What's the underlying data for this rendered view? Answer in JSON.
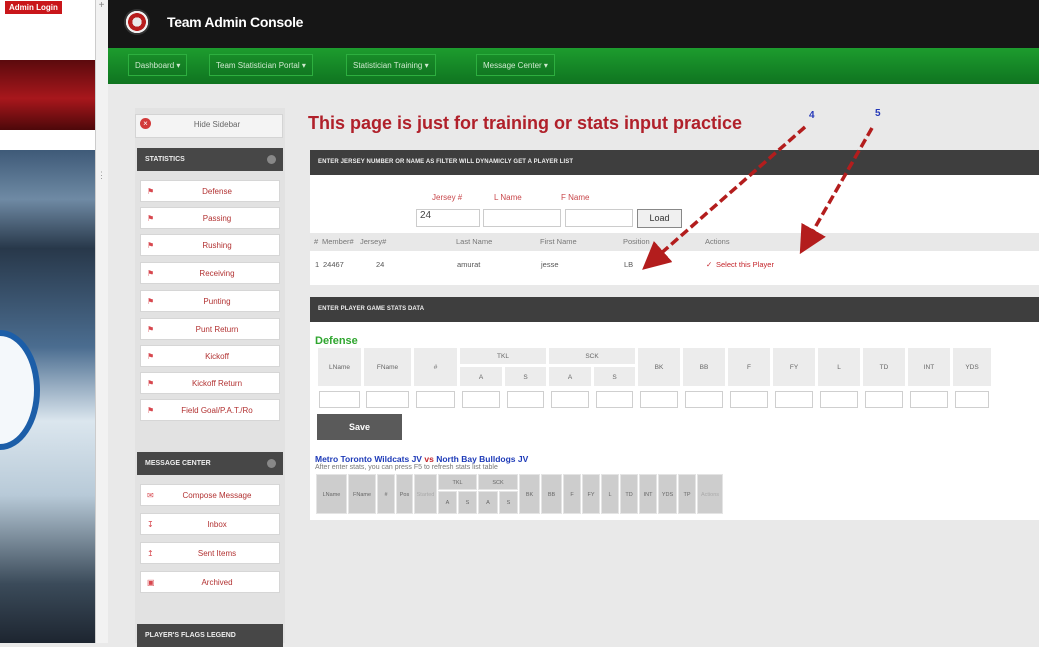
{
  "left_panel": {
    "admin_login": "Admin Login",
    "scroll_plus": "+",
    "scroll_mark": "⋮"
  },
  "header": {
    "app_title": "Team Admin Console"
  },
  "nav": {
    "items": [
      {
        "label": "Dashboard ▾"
      },
      {
        "label": "Team Statistician Portal ▾"
      },
      {
        "label": "Statistician Training ▾"
      },
      {
        "label": "Message Center ▾"
      }
    ]
  },
  "sidebar": {
    "hide_label": "Hide Sidebar",
    "statistics_heading": "STATISTICS",
    "statistics_items": [
      {
        "label": "Defense",
        "icon": "flag-icon"
      },
      {
        "label": "Passing",
        "icon": "flag-icon"
      },
      {
        "label": "Rushing",
        "icon": "flag-icon"
      },
      {
        "label": "Receiving",
        "icon": "flag-icon"
      },
      {
        "label": "Punting",
        "icon": "flag-icon"
      },
      {
        "label": "Punt Return",
        "icon": "flag-icon"
      },
      {
        "label": "Kickoff",
        "icon": "flag-icon"
      },
      {
        "label": "Kickoff Return",
        "icon": "flag-icon"
      },
      {
        "label": "Field Goal/P.A.T./Ro",
        "icon": "flag-icon"
      }
    ],
    "message_heading": "MESSAGE CENTER",
    "message_items": [
      {
        "label": "Compose Message"
      },
      {
        "label": "Inbox"
      },
      {
        "label": "Sent Items"
      },
      {
        "label": "Archived"
      }
    ],
    "flags_heading": "PLAYER'S FLAGS LEGEND"
  },
  "main": {
    "page_title": "This page is just for training or stats input practice",
    "filter_panel": {
      "heading": "ENTER JERSEY NUMBER OR NAME AS FILTER WILL DYNAMICLY GET A PLAYER LIST",
      "jersey_label": "Jersey #",
      "lname_label": "L Name",
      "fname_label": "F Name",
      "jersey_value": "24",
      "lname_value": "",
      "fname_value": "",
      "load_label": "Load"
    },
    "player_table": {
      "headers": [
        "#",
        "Member#",
        "Jersey#",
        "Last Name",
        "First Name",
        "Position",
        "Actions"
      ],
      "rows": [
        {
          "index": "1",
          "member": "24467",
          "jersey": "24",
          "last": "amurat",
          "first": "jesse",
          "position": "LB",
          "action": "Select this Player"
        }
      ]
    },
    "stats_panel": {
      "heading": "ENTER PLAYER GAME STATS DATA",
      "section": "Defense",
      "headers": [
        "LName",
        "FName",
        "#",
        "TKL",
        "SCK",
        "BK",
        "BB",
        "F",
        "FY",
        "L",
        "TD",
        "INT",
        "YDS"
      ],
      "subheaders": [
        "A",
        "S",
        "A",
        "S"
      ],
      "save_label": "Save"
    },
    "game_table": {
      "team_a": "Metro Toronto Wildcats JV",
      "vs": "vs",
      "team_b": "North Bay Bulldogs JV",
      "note": "After enter stats, you can press F5 to refresh stats list table",
      "headers": [
        "LName",
        "FName",
        "#",
        "Pos",
        "Started",
        "TKL",
        "SCK",
        "BK",
        "BB",
        "F",
        "FY",
        "L",
        "TD",
        "INT",
        "YDS",
        "TP",
        "Actions"
      ],
      "subheaders": [
        "A",
        "S",
        "A",
        "S"
      ]
    },
    "annotations": [
      "4",
      "5"
    ],
    "accent_colors": {
      "title_red": "#b0202a",
      "nav_green": "#138a25",
      "arrow_red": "#b31d1d",
      "section_green": "#2fa62f"
    }
  }
}
